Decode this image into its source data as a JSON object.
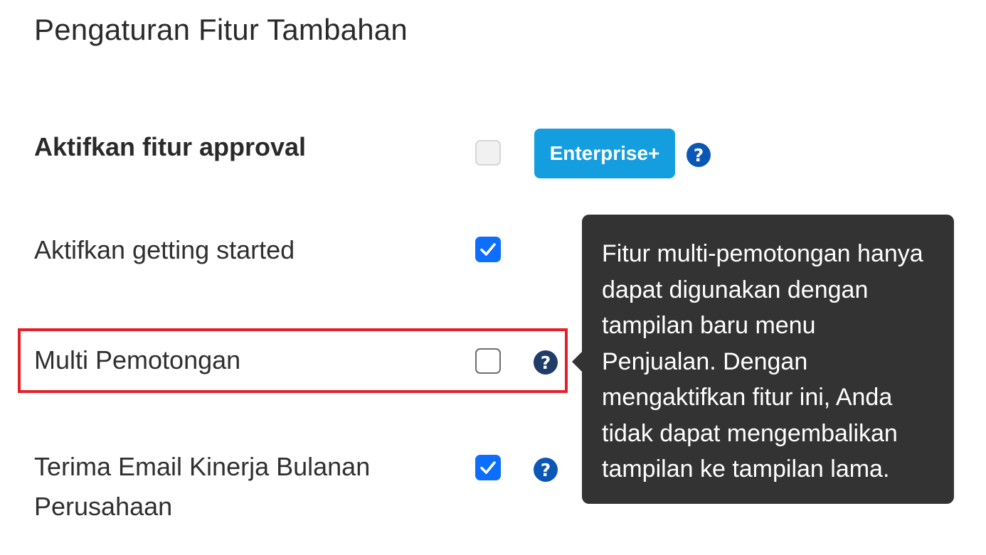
{
  "page": {
    "title": "Pengaturan Fitur Tambahan"
  },
  "settings": [
    {
      "label": "Aktifkan fitur approval",
      "checked": false,
      "disabled": true,
      "badge": "Enterprise+",
      "help_icon": "question-circle-icon"
    },
    {
      "label": "Aktifkan getting started",
      "checked": true
    },
    {
      "label": "Multi Pemotongan",
      "checked": false,
      "help_icon": "question-circle-icon",
      "highlighted": true
    },
    {
      "label_line1": "Terima Email Kinerja Bulanan",
      "label_line2": "Perusahaan",
      "checked": true,
      "help_icon": "question-circle-icon"
    }
  ],
  "tooltip": {
    "text": "Fitur multi-pemotongan hanya dapat digunakan dengan tampilan baru menu Penjualan. Dengan mengaktifkan fitur ini, Anda tidak dapat mengembalikan tampilan ke tampilan lama."
  },
  "colors": {
    "checkbox_checked": "#0d6efd",
    "badge": "#149ee0",
    "highlight_border": "#e3202a",
    "tooltip_bg": "#333333"
  },
  "help_glyph": "?",
  "check_glyph": "✓"
}
